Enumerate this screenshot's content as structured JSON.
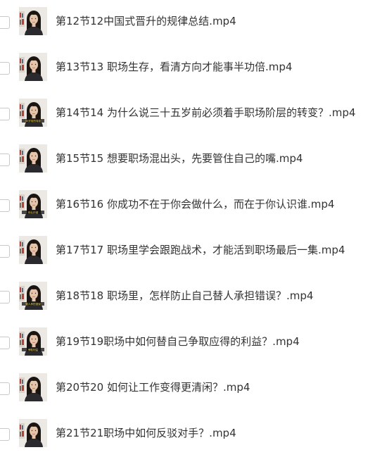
{
  "files": [
    {
      "name": "第12节12中国式晋升的规律总结.mp4",
      "thumb_caption": ""
    },
    {
      "name": "第13节13 职场生存，看清方向才能事半功倍.mp4",
      "thumb_caption": ""
    },
    {
      "name": "第14节14 为什么说三十五岁前必须着手职场阶层的转变？.mp4",
      "thumb_caption": "35岁前的转变"
    },
    {
      "name": "第15节15 想要职场混出头，先要管住自己的嘴.mp4",
      "thumb_caption": ""
    },
    {
      "name": "第16节16 你成功不在于你会做什么，而在于你认识谁.mp4",
      "thumb_caption": "你认识谁"
    },
    {
      "name": "第17节17 职场里学会跟跑战术，才能活到职场最后一集.mp4",
      "thumb_caption": ""
    },
    {
      "name": "第18节18 职场里，怎样防止自己替人承担错误？.mp4",
      "thumb_caption": "替人承担错误"
    },
    {
      "name": "第19节19职场中如何替自己争取应得的利益？.mp4",
      "thumb_caption": "争取利益"
    },
    {
      "name": "第20节20 如何让工作变得更清闲？.mp4",
      "thumb_caption": ""
    },
    {
      "name": "第21节21职场中如何反驳对手？.mp4",
      "thumb_caption": ""
    }
  ],
  "colors": {
    "text": "#333333",
    "checkbox_border": "#c9c9c9",
    "thumb_bg": "#ece8e4",
    "hair": "#1b1512",
    "skin": "#e6c4aa",
    "top": "#2a2a2e",
    "shelf_red": "#b5413a"
  }
}
